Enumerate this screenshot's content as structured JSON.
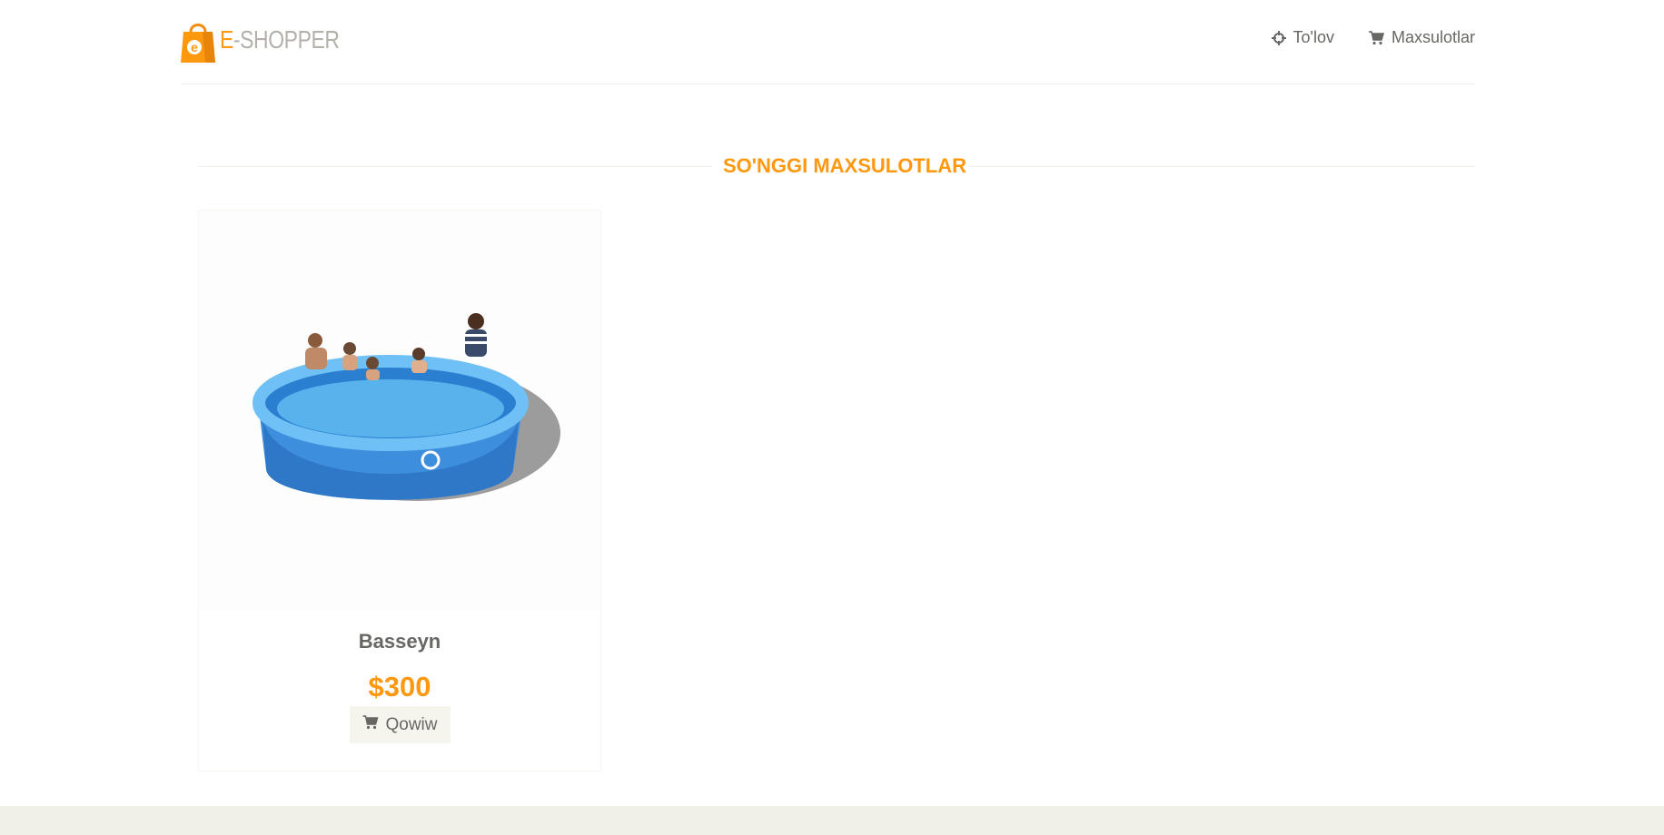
{
  "header": {
    "logo_prefix": "E",
    "logo_rest": "-SHOPPER",
    "nav": [
      {
        "label": "To'lov",
        "icon": "crosshairs-icon"
      },
      {
        "label": "Maxsulotlar",
        "icon": "shopping-cart-icon"
      }
    ]
  },
  "main": {
    "section_title": "SO'NGGI MAXSULOTLAR",
    "products": [
      {
        "name": "Basseyn",
        "price": "$300",
        "button_label": "Qowiw",
        "image": "inflatable-pool-image"
      }
    ]
  },
  "colors": {
    "accent": "#fe980f",
    "text": "#696763",
    "button_bg": "#f5f5ed",
    "footer_bg": "#f0f0e9"
  }
}
